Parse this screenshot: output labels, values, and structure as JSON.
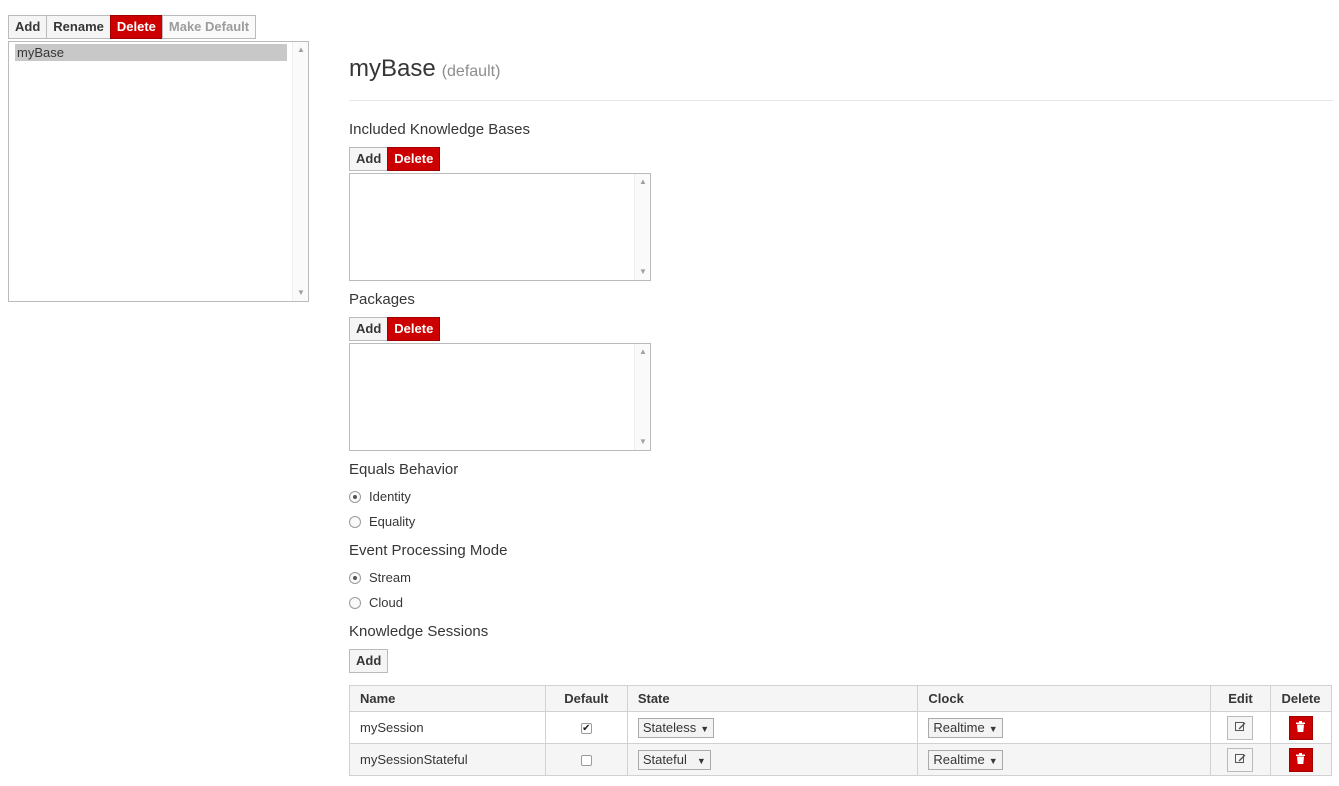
{
  "left_toolbar": {
    "add": "Add",
    "rename": "Rename",
    "delete": "Delete",
    "make_default": "Make Default"
  },
  "kbase_list": [
    "myBase"
  ],
  "main": {
    "title": "myBase",
    "title_suffix": "(default)",
    "included_kbases": {
      "label": "Included Knowledge Bases",
      "add": "Add",
      "delete": "Delete"
    },
    "packages": {
      "label": "Packages",
      "add": "Add",
      "delete": "Delete"
    },
    "equals_behavior": {
      "label": "Equals Behavior",
      "options": [
        "Identity",
        "Equality"
      ],
      "selected": "Identity"
    },
    "event_processing": {
      "label": "Event Processing Mode",
      "options": [
        "Stream",
        "Cloud"
      ],
      "selected": "Stream"
    },
    "sessions": {
      "label": "Knowledge Sessions",
      "add": "Add",
      "columns": [
        "Name",
        "Default",
        "State",
        "Clock",
        "Edit",
        "Delete"
      ],
      "rows": [
        {
          "name": "mySession",
          "default": true,
          "state": "Stateless",
          "clock": "Realtime"
        },
        {
          "name": "mySessionStateful",
          "default": false,
          "state": "Stateful",
          "clock": "Realtime"
        }
      ]
    }
  },
  "colors": {
    "danger": "#cc0000",
    "selected_row": "#c8c8c8",
    "text": "#363636"
  }
}
